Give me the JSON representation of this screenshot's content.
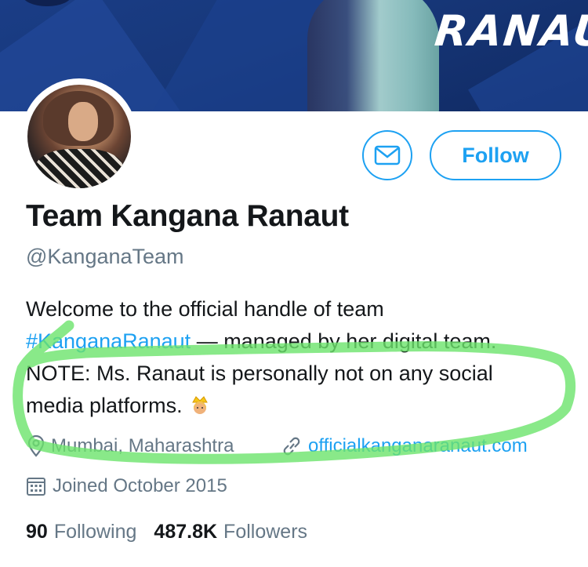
{
  "banner": {
    "text": "RANAUT"
  },
  "profile": {
    "name": "Team Kangana Ranaut",
    "handle": "@KanganaTeam",
    "follow_label": "Follow",
    "bio": {
      "line1": "Welcome to the official handle of team",
      "hashtag": "#KanganaRanaut",
      "line2_rest": " — managed by her digital team.",
      "line3": "NOTE: Ms. Ranaut is personally not on any social",
      "line4": "media platforms. "
    },
    "location": "Mumbai, Maharashtra",
    "website": "officialkanganaranaut.com",
    "joined": "Joined October 2015",
    "following_count": "90",
    "following_label": "Following",
    "followers_count": "487.8K",
    "followers_label": "Followers"
  },
  "colors": {
    "accent": "#1da1f2",
    "banner": "#173779",
    "highlight": "#6be36b"
  },
  "icons": [
    "mail-icon",
    "location-pin-icon",
    "link-icon",
    "calendar-icon",
    "crown-emoji-icon"
  ]
}
